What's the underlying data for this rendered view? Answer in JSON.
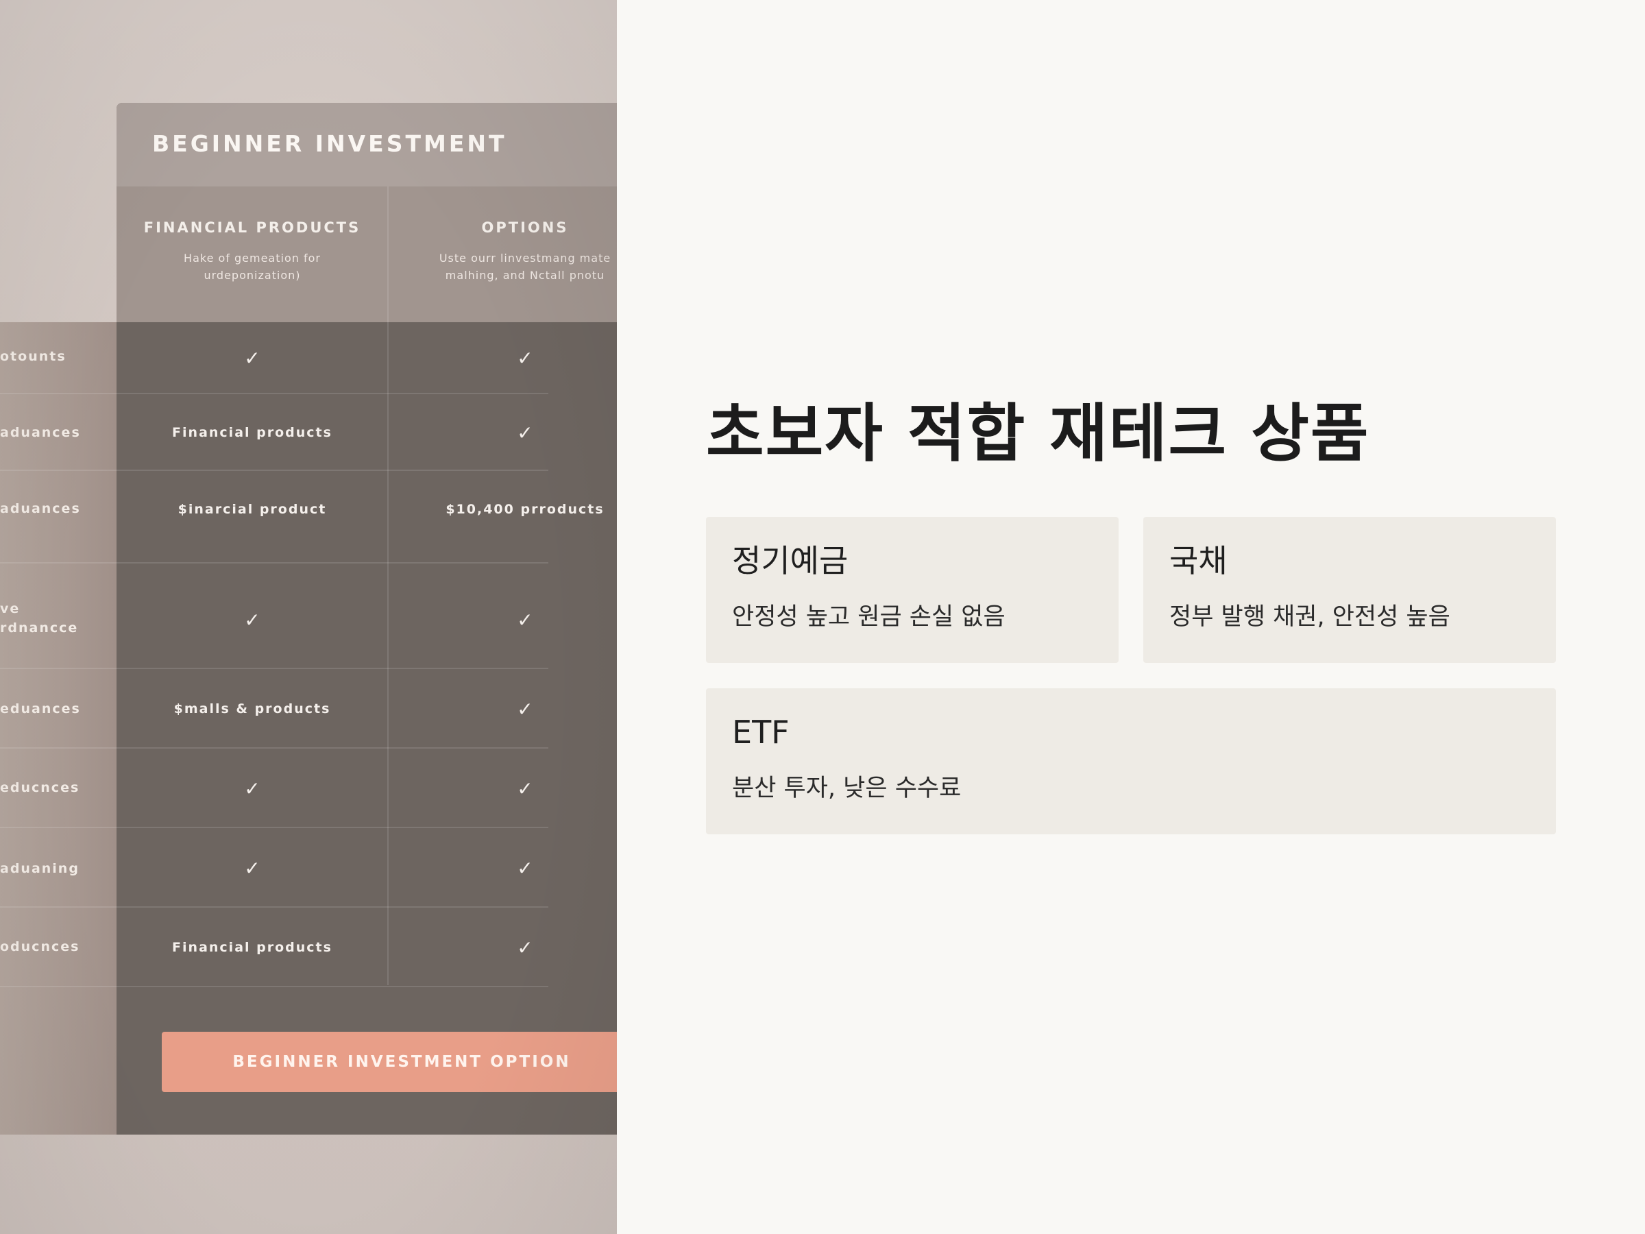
{
  "left_table": {
    "title": "BEGINNER INVESTMENT",
    "columns": [
      {
        "header": "FINANCIAL PRODUCTS",
        "subtext": "Hake of gemeation for\nurdeponization)"
      },
      {
        "header": "OPTIONS",
        "subtext": "Uste ourr linvestmang mate\nmalhing, and Nctall pnotu"
      }
    ],
    "rows": [
      {
        "label": "otounts",
        "c1": "✓",
        "c2": "✓"
      },
      {
        "label": "aduances",
        "c1": "Financial products",
        "c2": "✓"
      },
      {
        "label": "aduances",
        "c1": "$inarcial product",
        "c2": "$10,400 prroducts"
      },
      {
        "label": "ve\nrdnancce",
        "c1": "✓",
        "c2": "✓"
      },
      {
        "label": "eduances",
        "c1": "$malls & products",
        "c2": "✓"
      },
      {
        "label": "educnces",
        "c1": "✓",
        "c2": "✓"
      },
      {
        "label": "aduaning",
        "c1": "✓",
        "c2": "✓"
      },
      {
        "label": "oducnces",
        "c1": "Financial products",
        "c2": "✓"
      }
    ],
    "button_label": "BEGINNER INVESTMENT OPTION"
  },
  "content": {
    "title": "초보자 적합 재테크 상품",
    "cards": [
      {
        "name": "정기예금",
        "desc": "안정성 높고 원금 손실 없음"
      },
      {
        "name": "국채",
        "desc": "정부 발행 채권, 안전성 높음"
      },
      {
        "name": "ETF",
        "desc": "분산 투자, 낮은 수수료"
      }
    ]
  }
}
